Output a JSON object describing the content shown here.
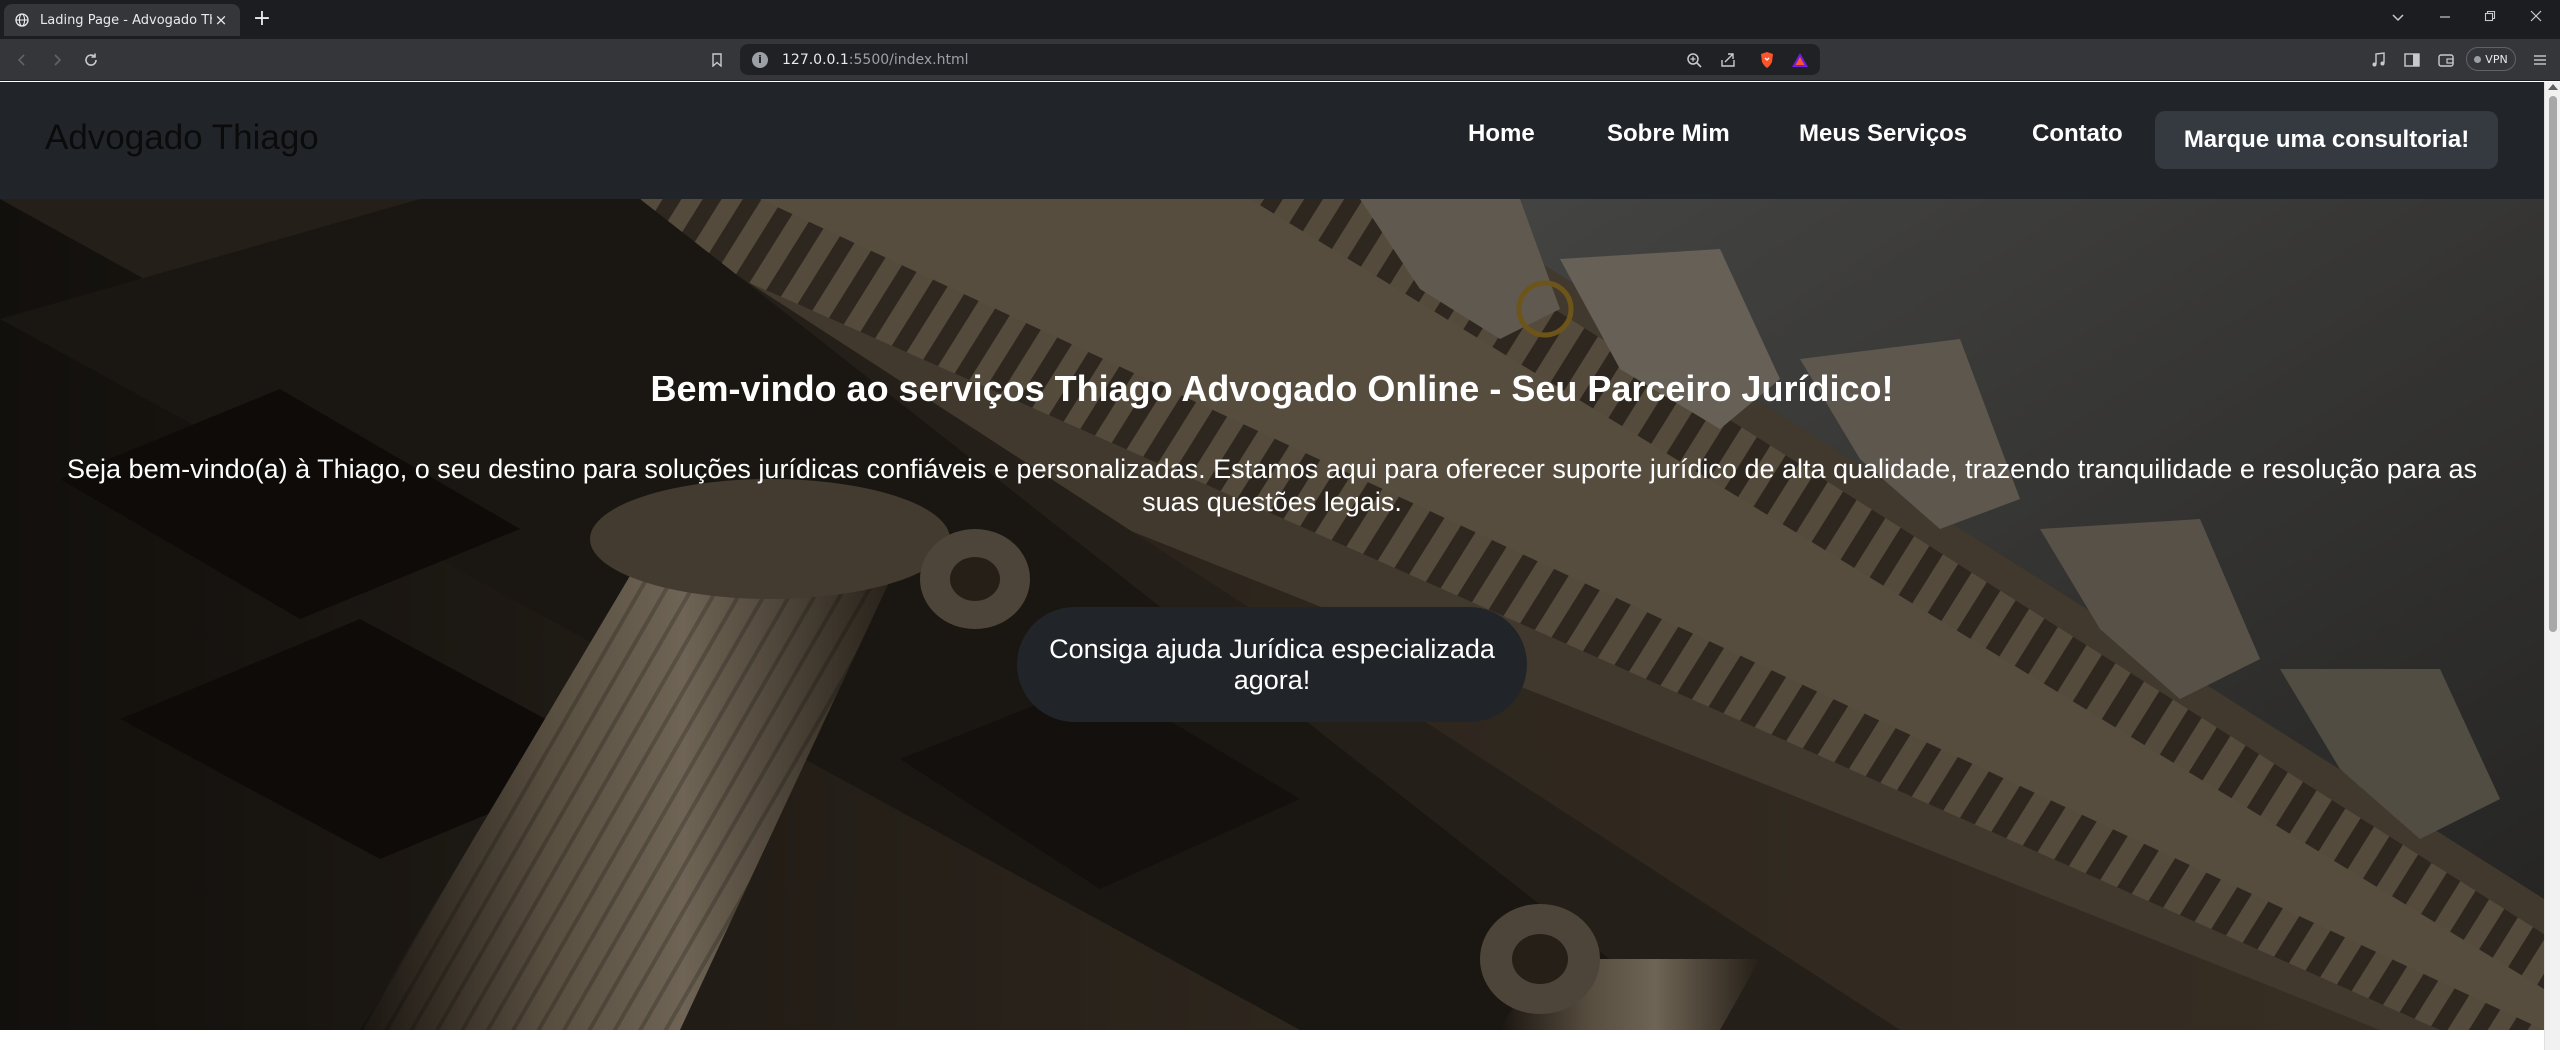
{
  "browser": {
    "tab_title": "Lading Page - Advogado Thiago",
    "tab_close": "×",
    "new_tab": "+",
    "url_host": "127.0.0.1",
    "url_path": ":5500/index.html",
    "vpn_label": "VPN",
    "icons": [
      "back-icon",
      "forward-icon",
      "reload-icon",
      "bookmark-icon",
      "site-info-icon",
      "zoom-icon",
      "share-icon",
      "brave-shields-icon",
      "brave-rewards-icon",
      "media-icon",
      "sidebar-icon",
      "wallet-icon",
      "menu-icon"
    ]
  },
  "header": {
    "logo": "Advogado Thiago",
    "nav": [
      "Home",
      "Sobre Mim",
      "Meus Serviços",
      "Contato"
    ],
    "cta": "Marque uma consultoria!"
  },
  "hero": {
    "title": "Bem-vindo ao serviços Thiago Advogado Online - Seu Parceiro Jurídico!",
    "text": "Seja bem-vindo(a) à Thiago, o seu destino para soluções jurídicas confiáveis e personalizadas. Estamos aqui para oferecer suporte jurídico de alta qualidade, trazendo tranquilidade e resolução para as suas questões legais.",
    "cta": "Consiga ajuda Jurídica especializada agora!"
  },
  "colors": {
    "header_bg": "#212529",
    "nav_cta_bg": "#343a40",
    "hero_cta_bg": "#212529",
    "text": "#ffffff"
  }
}
